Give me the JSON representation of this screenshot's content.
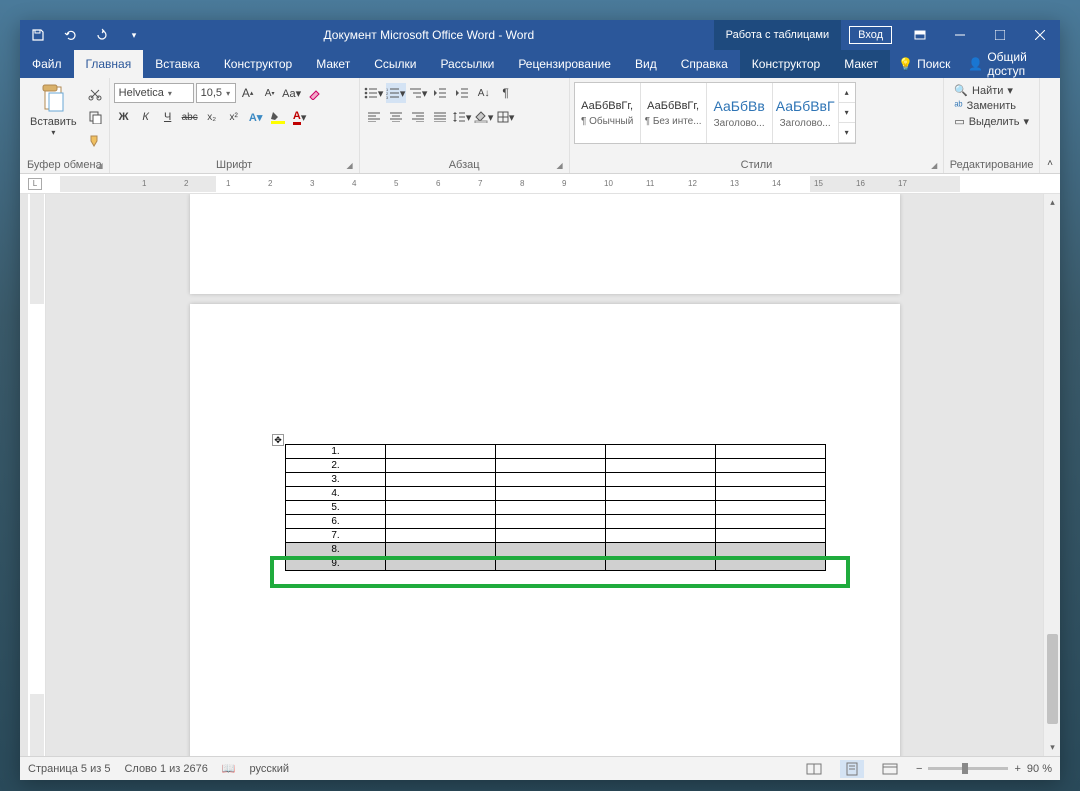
{
  "titlebar": {
    "title": "Документ Microsoft Office Word  -  Word",
    "tableMode": "Работа с таблицами",
    "login": "Вход"
  },
  "tabs": {
    "file": "Файл",
    "home": "Главная",
    "insert": "Вставка",
    "designer": "Конструктор",
    "layout": "Макет",
    "references": "Ссылки",
    "mailings": "Рассылки",
    "review": "Рецензирование",
    "view": "Вид",
    "help": "Справка",
    "tbl_designer": "Конструктор",
    "tbl_layout": "Макет",
    "search": "Поиск",
    "share": "Общий доступ"
  },
  "ribbon": {
    "clipboard": {
      "paste": "Вставить",
      "label": "Буфер обмена"
    },
    "font": {
      "name": "Helvetica",
      "size": "10,5",
      "label": "Шрифт",
      "bold": "Ж",
      "italic": "К",
      "underline": "Ч",
      "strike": "abc",
      "sub": "x₂",
      "sup": "x²"
    },
    "paragraph": {
      "label": "Абзац"
    },
    "styles": {
      "label": "Стили",
      "items": [
        {
          "preview": "АаБбВвГг,",
          "name": "¶ Обычный",
          "blue": false
        },
        {
          "preview": "АаБбВвГг,",
          "name": "¶ Без инте...",
          "blue": false
        },
        {
          "preview": "АаБбВв",
          "name": "Заголово...",
          "blue": true
        },
        {
          "preview": "АаБбВвГ",
          "name": "Заголово...",
          "blue": true
        }
      ]
    },
    "editing": {
      "label": "Редактирование",
      "find": "Найти",
      "replace": "Заменить",
      "select": "Выделить"
    }
  },
  "ruler": {
    "marks": [
      "",
      "1",
      "2",
      "1",
      "2",
      "3",
      "4",
      "5",
      "6",
      "7",
      "8",
      "9",
      "10",
      "11",
      "12",
      "13",
      "14",
      "15",
      "16",
      "17"
    ]
  },
  "table": {
    "rows": [
      "1.",
      "2.",
      "3.",
      "4.",
      "5.",
      "6.",
      "7.",
      "8.",
      "9."
    ],
    "selected": [
      7,
      8
    ]
  },
  "statusbar": {
    "page": "Страница 5 из 5",
    "words": "Слово 1 из 2676",
    "language": "русский",
    "zoom": "90 %"
  }
}
